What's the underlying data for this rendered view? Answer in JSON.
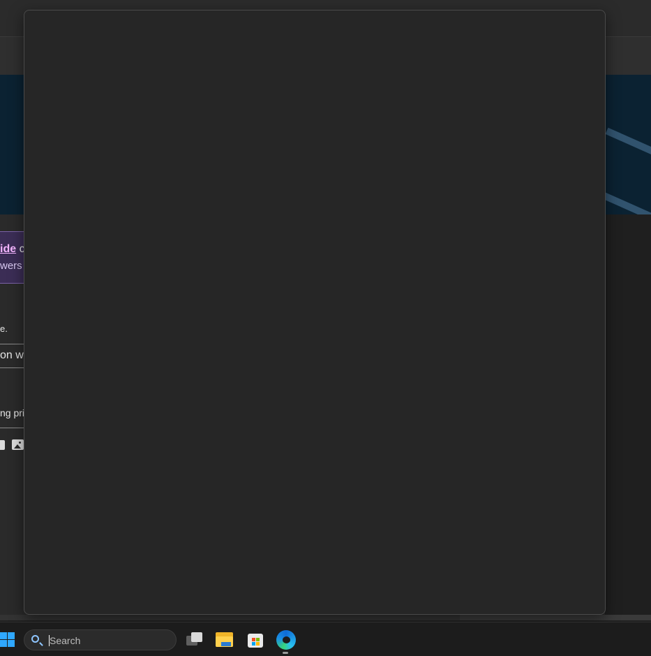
{
  "background_page": {
    "notice": {
      "link_fragment": "ide",
      "after_link": " c",
      "second_line_fragment": "wers"
    },
    "text_fragments": {
      "line_a": "e.",
      "line_b": "on wit",
      "line_c": "ng priv"
    }
  },
  "taskbar": {
    "search_placeholder": "Search",
    "apps": [
      "task-view",
      "file-explorer",
      "microsoft-store",
      "edge"
    ]
  },
  "icons": {
    "start": "windows-logo-icon",
    "search": "search-icon",
    "code": "code-icon",
    "image": "image-icon"
  },
  "colors": {
    "dialog_bg": "#262626",
    "notice_bg": "#3b2d55",
    "link": "#f4b5ff",
    "windows_blue": "#2fa8ff"
  }
}
